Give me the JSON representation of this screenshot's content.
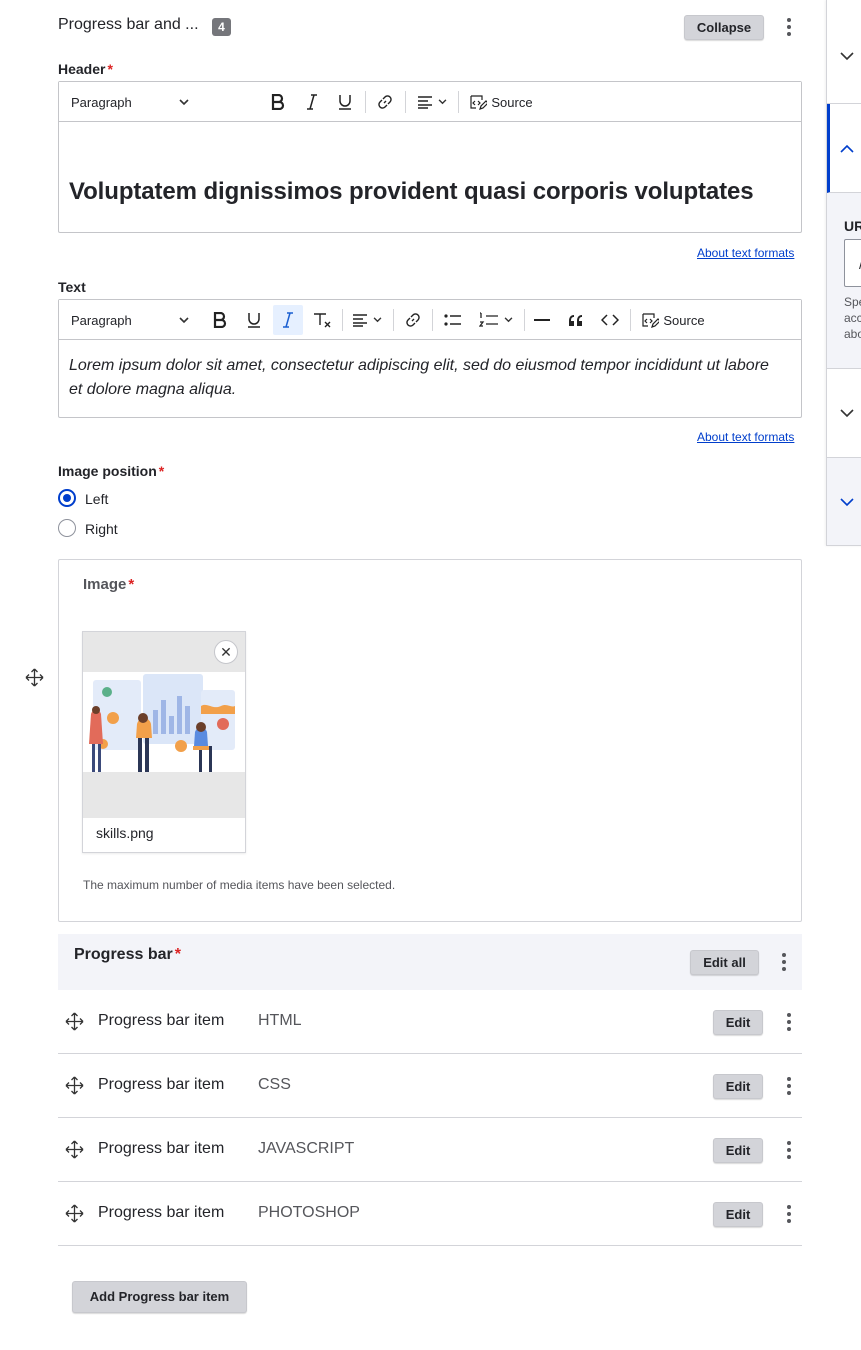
{
  "paragraph": {
    "title": "Progress bar and ...",
    "count": "4",
    "collapse_label": "Collapse"
  },
  "header_field": {
    "label": "Header",
    "required_mark": "*",
    "format_select": "Paragraph",
    "source_label": "Source",
    "content": "Voluptatem dignissimos provident quasi corporis voluptates",
    "help_link": "About text formats"
  },
  "text_field": {
    "label": "Text",
    "required_mark": "",
    "format_select": "Paragraph",
    "source_label": "Source",
    "content": "Lorem ipsum dolor sit amet, consectetur adipiscing elit, sed do eiusmod tempor incididunt ut labore et dolore magna aliqua.",
    "help_link": "About text formats"
  },
  "image_position": {
    "label": "Image position",
    "required_mark": "*",
    "options": [
      {
        "label": "Left",
        "checked": true
      },
      {
        "label": "Right",
        "checked": false
      }
    ]
  },
  "image_field": {
    "label": "Image",
    "required_mark": "*",
    "filename": "skills.png",
    "note": "The maximum number of media items have been selected.",
    "remove_icon": "close-icon"
  },
  "progress_bar": {
    "label": "Progress bar",
    "required_mark": "*",
    "edit_all_label": "Edit all",
    "items": [
      {
        "title": "Progress bar item",
        "summary": "HTML",
        "edit_label": "Edit"
      },
      {
        "title": "Progress bar item",
        "summary": "CSS",
        "edit_label": "Edit"
      },
      {
        "title": "Progress bar item",
        "summary": "JAVASCRIPT",
        "edit_label": "Edit"
      },
      {
        "title": "Progress bar item",
        "summary": "PHOTOSHOP",
        "edit_label": "Edit"
      }
    ],
    "add_label": "Add Progress bar item"
  },
  "sidebar": {
    "field_label_fragment": "UR",
    "input_fragment": "/",
    "help_fragment": [
      "Spe",
      "acc",
      "abo"
    ]
  },
  "colors": {
    "accent": "#003ecc",
    "required": "#dc2323",
    "table_header_bg": "#f3f4f9",
    "button_bg": "#d3d4d9"
  }
}
